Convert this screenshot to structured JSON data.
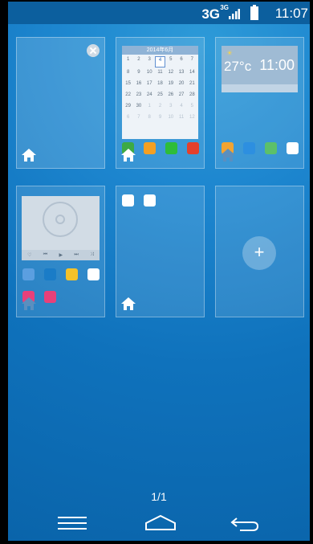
{
  "status_bar": {
    "network": "3G",
    "network_small": "3G",
    "time": "11:07"
  },
  "pages": {
    "indicator": "1/1"
  },
  "cards": [
    {
      "name": "empty",
      "close": true
    },
    {
      "calendar": {
        "title": "2014年6月",
        "weeks": [
          [
            "1",
            "2",
            "3",
            "4",
            "5",
            "6",
            "7"
          ],
          [
            "8",
            "9",
            "10",
            "11",
            "12",
            "13",
            "14"
          ],
          [
            "15",
            "16",
            "17",
            "18",
            "19",
            "20",
            "21"
          ],
          [
            "22",
            "23",
            "24",
            "25",
            "26",
            "27",
            "28"
          ],
          [
            "29",
            "30",
            "1",
            "2",
            "3",
            "4",
            "5"
          ],
          [
            "6",
            "7",
            "8",
            "9",
            "10",
            "11",
            "12"
          ]
        ],
        "today": "4"
      },
      "apps": [
        {
          "label": "",
          "color": "#3daa44"
        },
        {
          "label": "",
          "color": "#f4a022"
        },
        {
          "label": "",
          "color": "#2ebd3a"
        },
        {
          "label": "",
          "color": "#e4402c"
        }
      ]
    },
    {
      "clock_widget": {
        "temp": "27°c",
        "time": "11:00"
      },
      "apps": [
        {
          "label": "",
          "color": "#f2a432"
        },
        {
          "label": "",
          "color": "#2d8fe0"
        },
        {
          "label": "",
          "color": "#5cc06a"
        },
        {
          "label": "",
          "color": "#ffffff"
        }
      ]
    },
    {
      "music_widget": {
        "controls": [
          "♡",
          "⏮",
          "▶",
          "⏭",
          "⤨"
        ]
      },
      "apps_row1": [
        {
          "label": "",
          "color": "#5b9fe0"
        },
        {
          "label": "",
          "color": "#1a7cc7"
        },
        {
          "label": "",
          "color": "#f4c22a"
        },
        {
          "label": "",
          "color": "#ffffff"
        }
      ],
      "apps_row2": [
        {
          "label": "",
          "color": "#e8407a"
        },
        {
          "label": "",
          "color": "#e8407a"
        }
      ]
    },
    {
      "apps": [
        {
          "label": "",
          "color": "#ffffff"
        },
        {
          "label": "",
          "color": "#ffffff"
        }
      ]
    },
    {
      "plus": "+"
    }
  ]
}
